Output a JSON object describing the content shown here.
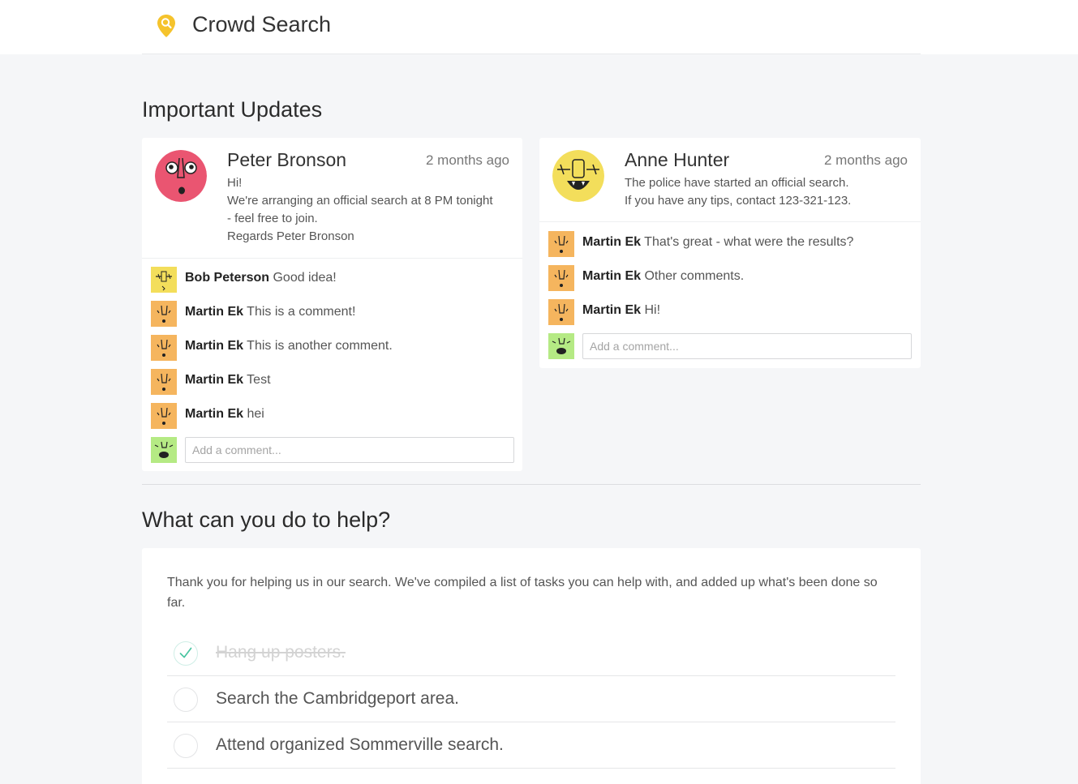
{
  "app": {
    "title": "Crowd Search"
  },
  "updates": {
    "heading": "Important Updates",
    "posts": [
      {
        "author": "Peter Bronson",
        "time": "2 months ago",
        "lines": [
          "Hi!",
          "We're arranging an official search at 8 PM tonight",
          "- feel free to join.",
          "Regards Peter Bronson"
        ],
        "comments": [
          {
            "name": "Bob Peterson",
            "text": "Good idea!"
          },
          {
            "name": "Martin Ek",
            "text": "This is a comment!"
          },
          {
            "name": "Martin Ek",
            "text": "This is another comment."
          },
          {
            "name": "Martin Ek",
            "text": "Test"
          },
          {
            "name": "Martin Ek",
            "text": "hei"
          }
        ],
        "comment_placeholder": "Add a comment..."
      },
      {
        "author": "Anne Hunter",
        "time": "2 months ago",
        "lines": [
          "The police have started an official search.",
          "If you have any tips, contact 123-321-123."
        ],
        "comments": [
          {
            "name": "Martin Ek",
            "text": "That's great - what were the results?"
          },
          {
            "name": "Martin Ek",
            "text": "Other comments."
          },
          {
            "name": "Martin Ek",
            "text": "Hi!"
          }
        ],
        "comment_placeholder": "Add a comment..."
      }
    ]
  },
  "help": {
    "heading": "What can you do to help?",
    "intro": "Thank you for helping us in our search. We've compiled a list of tasks you can help with, and added up what's been done so far.",
    "tasks": [
      {
        "label": "Hang up posters.",
        "done": true
      },
      {
        "label": "Search the Cambridgeport area.",
        "done": false
      },
      {
        "label": "Attend organized Sommerville search.",
        "done": false
      }
    ]
  },
  "colors": {
    "brand_yellow": "#f5c32c",
    "avatar_pink": "#ea5571",
    "avatar_yellow": "#f3de5b",
    "avatar_orange": "#f5b55e",
    "avatar_green": "#b5ea84",
    "check_green": "#48c4a0"
  },
  "icons": [
    "map-pin-search-icon",
    "face-avatar-icon",
    "check-icon"
  ]
}
